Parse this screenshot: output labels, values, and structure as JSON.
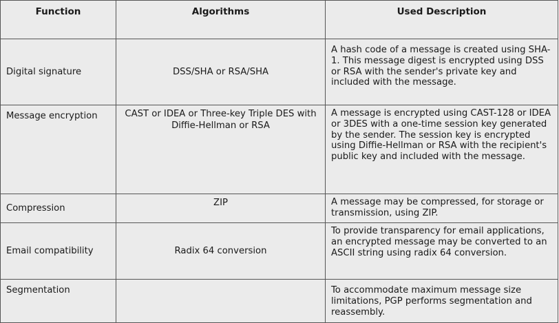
{
  "headers": {
    "function": "Function",
    "algorithms": "Algorithms",
    "description": "Used Description"
  },
  "rows": [
    {
      "function": "Digital signature",
      "algorithms": "DSS/SHA or RSA/SHA",
      "description": "A hash code of a message is created using SHA-1. This message digest is encrypted using DSS or RSA with the sender's private key and included with the message."
    },
    {
      "function": "Message encryption",
      "algorithms": "CAST or IDEA or Three-key Triple DES with Diffie-Hellman or RSA",
      "description": "A message is encrypted using CAST-128 or IDEA or 3DES with a one-time session key generated by the sender. The session key is encrypted using Diffie-Hellman or RSA with the recipient's public key and included with the message."
    },
    {
      "function": "Compression",
      "algorithms": "ZIP",
      "description": "A message may be compressed, for storage or transmission, using ZIP."
    },
    {
      "function": "Email compatibility",
      "algorithms": "Radix 64 conversion",
      "description": "To provide transparency for email applications, an encrypted message may be converted to an ASCII string using radix 64 conversion."
    },
    {
      "function": "Segmentation",
      "algorithms": "",
      "description": "To accommodate maximum message size limitations, PGP performs segmentation and reassembly."
    }
  ]
}
